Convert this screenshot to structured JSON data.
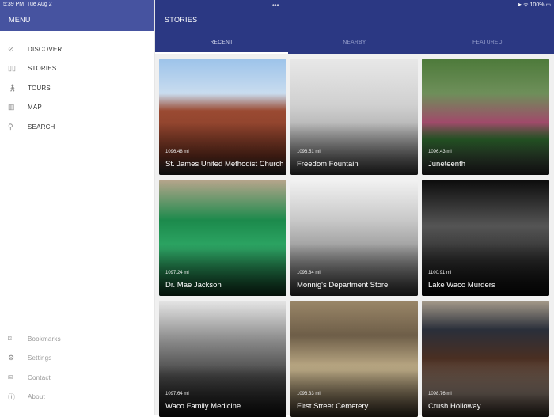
{
  "status": {
    "time": "5:39 PM",
    "date": "Tue Aug 2",
    "battery": "100%"
  },
  "sidebar": {
    "title": "MENU",
    "items": [
      {
        "label": "DISCOVER",
        "icon": "compass-icon"
      },
      {
        "label": "STORIES",
        "icon": "book-icon"
      },
      {
        "label": "TOURS",
        "icon": "walking-icon"
      },
      {
        "label": "MAP",
        "icon": "map-icon"
      },
      {
        "label": "SEARCH",
        "icon": "search-icon"
      }
    ],
    "footer": [
      {
        "label": "Bookmarks",
        "icon": "bookmark-icon"
      },
      {
        "label": "Settings",
        "icon": "gear-icon"
      },
      {
        "label": "Contact",
        "icon": "mail-icon"
      },
      {
        "label": "About",
        "icon": "info-icon"
      }
    ]
  },
  "main": {
    "title": "STORIES",
    "tabs": [
      "RECENT",
      "NEARBY",
      "FEATURED"
    ],
    "stories": [
      {
        "name": "St. James United Methodist Church",
        "distance": "1096.48 mi"
      },
      {
        "name": "Freedom Fountain",
        "distance": "1096.51 mi"
      },
      {
        "name": "Juneteenth",
        "distance": "1096.43 mi"
      },
      {
        "name": "Dr. Mae Jackson",
        "distance": "1097.24 mi"
      },
      {
        "name": "Monnig's Department Store",
        "distance": "1096.84 mi"
      },
      {
        "name": "Lake Waco Murders",
        "distance": "1100.91 mi"
      },
      {
        "name": "Waco Family Medicine",
        "distance": "1097.64 mi"
      },
      {
        "name": "First Street Cemetery",
        "distance": "1096.33 mi"
      },
      {
        "name": "Crush Holloway",
        "distance": "1098.76 mi"
      }
    ]
  }
}
